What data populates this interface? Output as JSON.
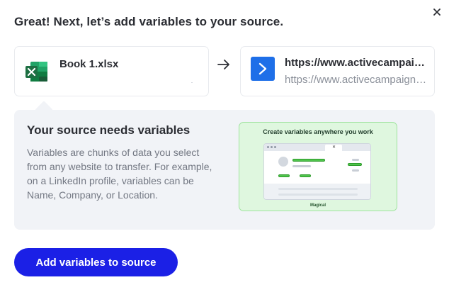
{
  "dialog": {
    "title": "Great! Next, let’s add variables to your source.",
    "close_icon": "close-icon"
  },
  "source_card": {
    "icon": "excel-icon",
    "name": "Book 1.xlsx"
  },
  "connector_icon": "arrow-right-icon",
  "destination_card": {
    "icon": "activecampaign-icon",
    "title": "https://www.activecampaign.com",
    "subtitle": "https://www.activecampaign.com"
  },
  "info_panel": {
    "heading": "Your source needs variables",
    "body": "Variables are chunks of data you select from any website to transfer. For example, on a LinkedIn profile, variables can be Name, Company, or Location.",
    "illustration": {
      "title": "Create variables anywhere you work",
      "logo_text": "Magical"
    }
  },
  "primary_action": {
    "label": "Add variables to source"
  },
  "colors": {
    "accent": "#1b20e6",
    "panel_bg": "#f1f3f7",
    "excel_green": "#1d6f42",
    "activecampaign_blue": "#1e6fe8",
    "illustration_bg": "#dff7df"
  }
}
